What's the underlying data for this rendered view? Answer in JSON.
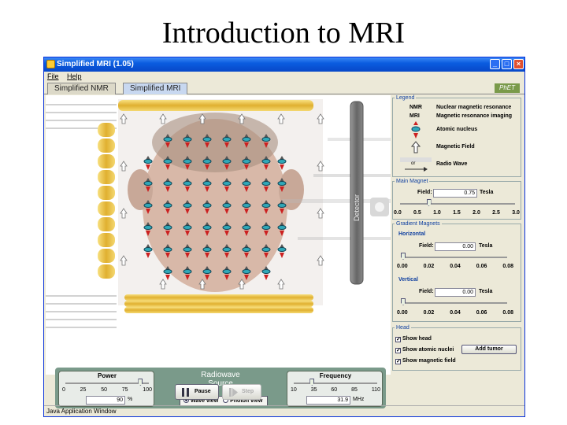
{
  "slide": {
    "title": "Introduction to MRI"
  },
  "window": {
    "title": "Simplified MRI (1.05)",
    "minimize_icon": "minimize-icon",
    "maximize_icon": "maximize-icon",
    "close_icon": "close-icon"
  },
  "menu": {
    "items": [
      "File",
      "Help"
    ]
  },
  "tabs": [
    {
      "label": "Simplified NMR",
      "active": false
    },
    {
      "label": "Simplified MRI",
      "active": true
    }
  ],
  "logo_text": "PhET",
  "sim": {
    "detector_label": "Detector"
  },
  "legend": {
    "title": "Legend",
    "items": [
      {
        "symbol": "NMR",
        "text": "Nuclear magnetic resonance"
      },
      {
        "symbol": "MRI",
        "text": "Magnetic resonance imaging"
      },
      {
        "symbol": "atomic-nucleus-icon",
        "text": "Atomic nucleus"
      },
      {
        "symbol": "magnetic-field-arrow-icon",
        "text": "Magnetic Field"
      },
      {
        "symbol": "radio-wave-icon",
        "text": "Radio Wave",
        "or_text": "or"
      }
    ]
  },
  "main_magnet": {
    "title": "Main Magnet",
    "field_label": "Field:",
    "field_value": "0.75",
    "unit": "Tesla",
    "ticks": [
      "0.0",
      "0.5",
      "1.0",
      "1.5",
      "2.0",
      "2.5",
      "3.0"
    ],
    "slider_fraction": 0.25
  },
  "gradient": {
    "title": "Gradient Magnets",
    "horizontal": {
      "title": "Horizontal",
      "field_label": "Field:",
      "field_value": "0.00",
      "unit": "Tesla",
      "ticks": [
        "0.00",
        "0.02",
        "0.04",
        "0.06",
        "0.08"
      ],
      "slider_fraction": 0
    },
    "vertical": {
      "title": "Vertical",
      "field_label": "Field:",
      "field_value": "0.00",
      "unit": "Tesla",
      "ticks": [
        "0.00",
        "0.02",
        "0.04",
        "0.06",
        "0.08"
      ],
      "slider_fraction": 0
    }
  },
  "head": {
    "title": "Head",
    "show_head": "Show head",
    "show_nuclei": "Show atomic nuclei",
    "show_field": "Show magnetic field",
    "add_tumor": "Add tumor",
    "show_head_checked": true,
    "show_nuclei_checked": true,
    "show_field_checked": true
  },
  "power": {
    "title": "Power",
    "ticks": [
      "0",
      "25",
      "50",
      "75",
      "100"
    ],
    "value": "90",
    "unit": "%",
    "slider_fraction": 0.9
  },
  "radiowave": {
    "line1": "Radiowave",
    "line2": "Source",
    "wave_view": "Wave view",
    "photon_view": "Photon view",
    "selected": "wave"
  },
  "frequency": {
    "title": "Frequency",
    "ticks": [
      "10",
      "35",
      "60",
      "85",
      "110"
    ],
    "value": "31.9",
    "unit": "MHz",
    "slider_fraction": 0.22
  },
  "controls": {
    "pause": "Pause",
    "step": "Step"
  },
  "status": "Java Application Window",
  "colors": {
    "titlebar": "#0a5ce0",
    "magnet_gold": "#e8c040",
    "detector": "#777777",
    "nucleus_red": "#cc2020",
    "nucleus_cyan": "#30a8b8"
  }
}
